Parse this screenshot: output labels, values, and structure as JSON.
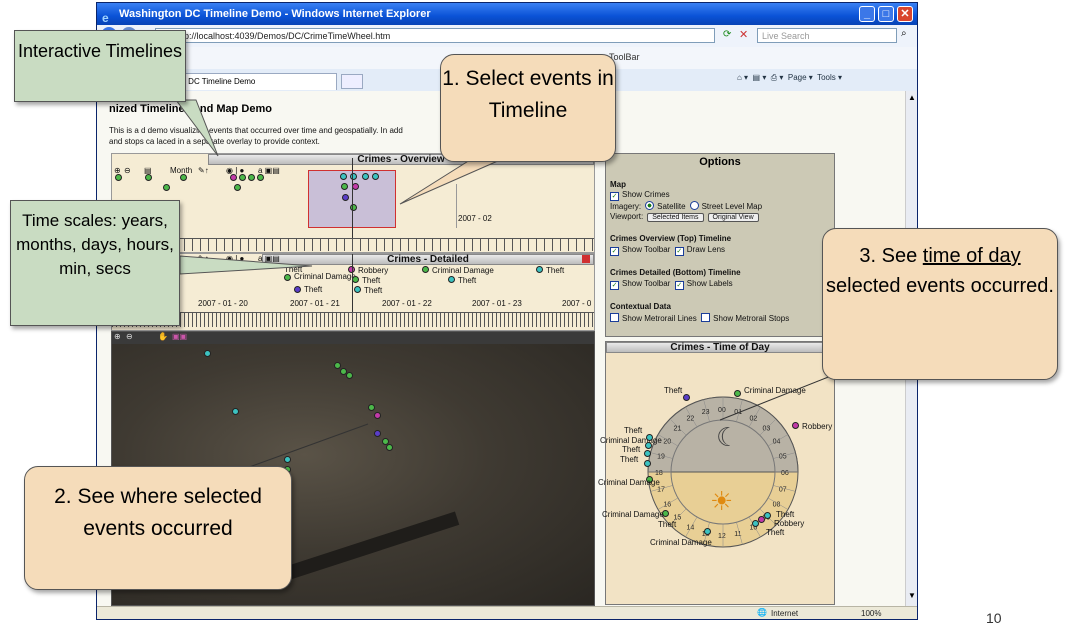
{
  "window": {
    "title": "Washington DC Timeline Demo - Windows Internet Explorer",
    "url": "http://localhost:4039/Demos/DC/CrimeTimeWheel.htm",
    "search_placeholder": "Live Search",
    "toolbar_label": "ToolBar",
    "tab_title": "Washington DC Timeline Demo",
    "tools": [
      "Page",
      "Tools"
    ],
    "status_zone": "Internet",
    "zoom": "100%"
  },
  "page": {
    "title": "nized Timelines and Map Demo",
    "description_line1": "This is a    d demo visualizing events that occurred over time and geospatially. In add",
    "description_line2": "and stops ca    laced in a separate overlay to provide context."
  },
  "overview": {
    "header": "Crimes - Overview",
    "zoom_unit": "Month",
    "tick_label": "2007 - 02"
  },
  "detailed": {
    "header": "Crimes - Detailed",
    "dates": [
      "2007 - 01 - 20",
      "2007 - 01 - 21",
      "2007 - 01 - 22",
      "2007 - 01 - 23",
      "2007 - 0"
    ],
    "events": [
      "Theft",
      "Criminal Damage",
      "Theft",
      "Robbery",
      "Theft",
      "Theft",
      "Criminal Damage",
      "Theft",
      "Theft"
    ]
  },
  "options": {
    "title": "Options",
    "map_heading": "Map",
    "show_crimes": "Show Crimes",
    "imagery_label": "Imagery:",
    "imagery_satellite": "Satellite",
    "imagery_street": "Street Level Map",
    "viewport_label": "Viewport:",
    "selected_items_button": "Selected Items",
    "original_view_button": "Original View",
    "overview_heading": "Crimes Overview (Top) Timeline",
    "show_toolbar_1": "Show Toolbar",
    "draw_lens": "Draw Lens",
    "detailed_heading": "Crimes Detailed (Bottom) Timeline",
    "show_toolbar_2": "Show Toolbar",
    "show_labels": "Show Labels",
    "contextual_heading": "Contextual Data",
    "metrorail_lines": "Show Metrorail Lines",
    "metrorail_stops": "Show Metrorail Stops"
  },
  "time_of_day": {
    "header": "Crimes - Time of Day",
    "hours": [
      "00",
      "01",
      "02",
      "03",
      "04",
      "05",
      "06",
      "07",
      "08",
      "09",
      "10",
      "11",
      "12",
      "13",
      "14",
      "15",
      "16",
      "17",
      "18",
      "19",
      "20",
      "21",
      "22",
      "23"
    ],
    "labels": {
      "theft_top": "Theft",
      "criminal_damage_top": "Criminal Damage",
      "robbery_right": "Robbery",
      "theft_l1": "Theft",
      "criminal_damage_l1": "Criminal Damage",
      "theft_l2": "Theft",
      "theft_l3": "Theft",
      "criminal_damage_l2": "Criminal Damage",
      "criminal_damage_bl": "Criminal Damage",
      "theft_bl": "Theft",
      "criminal_damage_bottom": "Criminal Damage",
      "theft_br1": "Theft",
      "robbery_br": "Robbery",
      "theft_br2": "Theft"
    }
  },
  "callouts": {
    "interactive": "Interactive Timelines",
    "select_events": "1. Select events in Timeline",
    "time_scales": "Time scales: years, months, days, hours, min, secs",
    "see_where": "2. See where selected events occurred",
    "see_time_prefix": "3. See ",
    "see_time_link": "time of day",
    "see_time_suffix": " selected events occurred."
  },
  "slide_number": "10",
  "colors": {
    "green": "#4cb84a",
    "magenta": "#c23aa8",
    "teal": "#3cc2c0",
    "purple": "#5a3ec8"
  }
}
